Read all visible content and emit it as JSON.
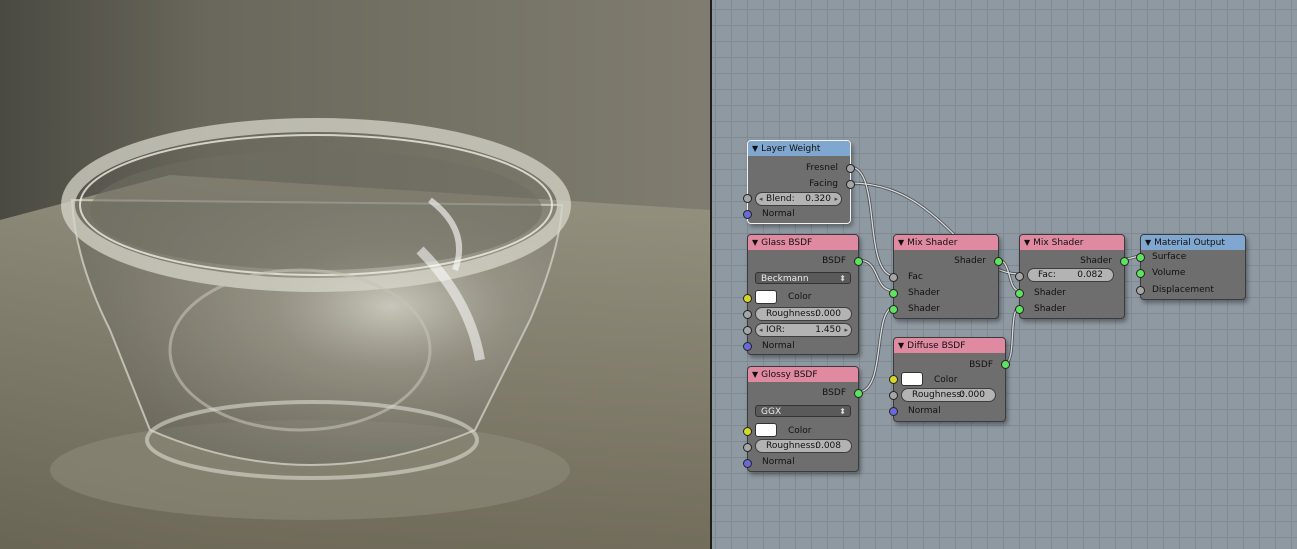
{
  "colors": {
    "editor_bg": "#8f99a2",
    "input_header": "#7fa7cf",
    "shader_header": "#e08aa1",
    "node_body": "#6e6e6e",
    "socket_shader": "#5fe25f",
    "socket_float": "#a6a6a6",
    "socket_color": "#d6d62b",
    "socket_vector": "#6a6ad6"
  },
  "nodes": {
    "layer_weight": {
      "title": "Layer Weight",
      "out_fresnel": "Fresnel",
      "out_facing": "Facing",
      "blend_label": "Blend:",
      "blend_value": "0.320",
      "in_normal": "Normal"
    },
    "glass": {
      "title": "Glass BSDF",
      "out_bsdf": "BSDF",
      "distribution": "Beckmann",
      "in_color": "Color",
      "roughness_label": "Roughness:",
      "roughness_value": "0.000",
      "ior_label": "IOR:",
      "ior_value": "1.450",
      "in_normal": "Normal"
    },
    "glossy": {
      "title": "Glossy BSDF",
      "out_bsdf": "BSDF",
      "distribution": "GGX",
      "in_color": "Color",
      "roughness_label": "Roughness:",
      "roughness_value": "0.008",
      "in_normal": "Normal"
    },
    "mix1": {
      "title": "Mix Shader",
      "out_shader": "Shader",
      "in_fac": "Fac",
      "in_shader1": "Shader",
      "in_shader2": "Shader"
    },
    "diffuse": {
      "title": "Diffuse BSDF",
      "out_bsdf": "BSDF",
      "in_color": "Color",
      "roughness_label": "Roughness:",
      "roughness_value": "0.000",
      "in_normal": "Normal"
    },
    "mix2": {
      "title": "Mix Shader",
      "out_shader": "Shader",
      "fac_label": "Fac:",
      "fac_value": "0.082",
      "in_shader1": "Shader",
      "in_shader2": "Shader"
    },
    "output": {
      "title": "Material Output",
      "in_surface": "Surface",
      "in_volume": "Volume",
      "in_displacement": "Displacement"
    }
  }
}
